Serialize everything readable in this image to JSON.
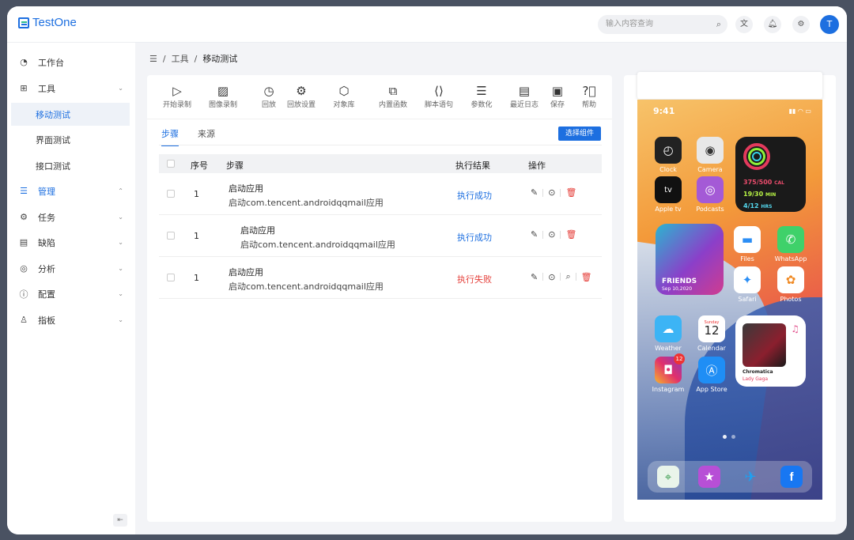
{
  "brand": {
    "name": "TestOne"
  },
  "header": {
    "search_placeholder": "输入内容查询",
    "avatar_letter": "T"
  },
  "sidebar": {
    "items": [
      {
        "label": "工作台",
        "icon": "dashboard-icon"
      },
      {
        "label": "工具",
        "icon": "grid-icon"
      },
      {
        "label": "移动测试"
      },
      {
        "label": "界面测试"
      },
      {
        "label": "接口测试"
      },
      {
        "label": "管理",
        "icon": "list-icon"
      },
      {
        "label": "任务",
        "icon": "gear-icon"
      },
      {
        "label": "缺陷",
        "icon": "document-icon"
      },
      {
        "label": "分析",
        "icon": "check-circle-icon"
      },
      {
        "label": "配置",
        "icon": "info-icon"
      },
      {
        "label": "指板",
        "icon": "user-icon"
      }
    ]
  },
  "breadcrumb": {
    "items": [
      "工具",
      "移动测试"
    ]
  },
  "toolbar": {
    "tools": [
      {
        "label": "开始录制",
        "icon": "play-file-icon"
      },
      {
        "label": "图像录制",
        "icon": "image-icon"
      },
      {
        "label": "回放",
        "icon": "history-icon"
      },
      {
        "label": "回放设置",
        "icon": "settings-icon"
      },
      {
        "label": "对象库",
        "icon": "cube-icon"
      },
      {
        "label": "内置函数",
        "icon": "function-icon"
      },
      {
        "label": "脚本语句",
        "icon": "code-icon"
      },
      {
        "label": "参数化",
        "icon": "list-icon"
      },
      {
        "label": "最近日志",
        "icon": "log-icon"
      },
      {
        "label": "保存",
        "icon": "save-icon"
      },
      {
        "label": "帮助",
        "icon": "help-icon"
      }
    ]
  },
  "tabs": {
    "steps": "步骤",
    "source": "来源",
    "select_button": "选择组件"
  },
  "table": {
    "headers": {
      "index": "序号",
      "step": "步骤",
      "result": "执行结果",
      "action": "操作"
    },
    "rows": [
      {
        "index": "1",
        "title": "启动应用",
        "detail": "启动com.tencent.androidqqmail应用",
        "result": "执行成功",
        "status": "success"
      },
      {
        "index": "1",
        "title": "启动应用",
        "detail": "启动com.tencent.androidqqmail应用",
        "result": "执行成功",
        "status": "success"
      },
      {
        "index": "1",
        "title": "启动应用",
        "detail": "启动com.tencent.androidqqmail应用",
        "result": "执行失败",
        "status": "fail"
      }
    ]
  },
  "phone": {
    "time": "9:41",
    "apps": {
      "clock": "Clock",
      "camera": "Camera",
      "appletv": "Apple tv",
      "podcasts": "Podcasts",
      "files": "Files",
      "whatsapp": "WhatsApp",
      "safari": "Safari",
      "photos": "Photos",
      "weather": "Weather",
      "calendar": "Calendar",
      "instagram": "Instagram",
      "appstore": "App Store"
    },
    "activity": {
      "move": "375/500",
      "move_unit": "CAL",
      "exercise": "19/30",
      "exercise_unit": "MIN",
      "stand": "4/12",
      "stand_unit": "HRS"
    },
    "friends": {
      "title": "FRIENDS",
      "date": "Sep 10,2020"
    },
    "calendar": {
      "day": "Sunday",
      "date": "12"
    },
    "instagram_badge": "12",
    "music": {
      "album": "Chromatica",
      "artist": "Lady Gaga"
    }
  },
  "colors": {
    "accent": "#1d6fe0",
    "success": "#1d6fe0",
    "fail": "#e5403b"
  }
}
